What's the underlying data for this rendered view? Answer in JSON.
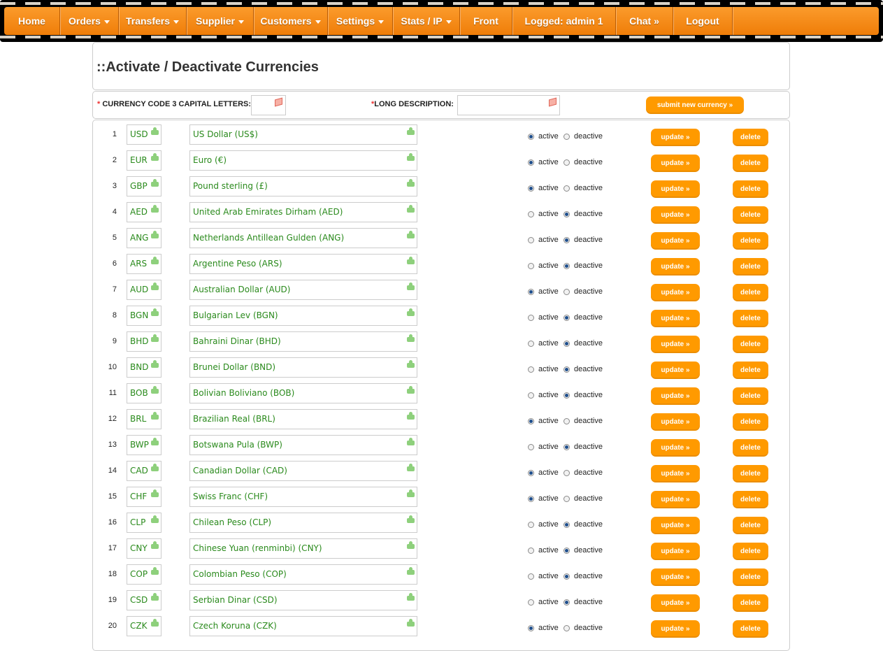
{
  "nav": {
    "items": [
      {
        "label": "Home",
        "caret": false
      },
      {
        "label": "Orders",
        "caret": true
      },
      {
        "label": "Transfers",
        "caret": true
      },
      {
        "label": "Supplier",
        "caret": true
      },
      {
        "label": "Customers",
        "caret": true
      },
      {
        "label": "Settings",
        "caret": true
      },
      {
        "label": "Stats / IP",
        "caret": true
      },
      {
        "label": "Front",
        "caret": false
      },
      {
        "label": "Logged: admin 1",
        "caret": false
      },
      {
        "label": "Chat »",
        "caret": false
      },
      {
        "label": "Logout",
        "caret": false
      }
    ]
  },
  "page": {
    "title": "::Activate / Deactivate Currencies"
  },
  "form": {
    "required_mark": "*",
    "code_label": " CURRENCY CODE 3 CAPITAL LETTERS:",
    "desc_label": "LONG DESCRIPTION:",
    "code_value": "",
    "desc_value": "",
    "submit_label": "submit new currency »"
  },
  "labels": {
    "active": "active",
    "deactive": "deactive",
    "update": "update »",
    "delete": "delete"
  },
  "colors": {
    "accent": "#ff9a00",
    "text_green": "#2a8a1c"
  },
  "currencies": [
    {
      "n": "1",
      "code": "USD",
      "desc": "US Dollar (US$)",
      "active": true
    },
    {
      "n": "2",
      "code": "EUR",
      "desc": "Euro (€)",
      "active": true
    },
    {
      "n": "3",
      "code": "GBP",
      "desc": "Pound sterling (£)",
      "active": true
    },
    {
      "n": "4",
      "code": "AED",
      "desc": "United Arab Emirates Dirham (AED)",
      "active": false
    },
    {
      "n": "5",
      "code": "ANG",
      "desc": "Netherlands Antillean Gulden (ANG)",
      "active": false
    },
    {
      "n": "6",
      "code": "ARS",
      "desc": "Argentine Peso (ARS)",
      "active": false
    },
    {
      "n": "7",
      "code": "AUD",
      "desc": "Australian Dollar (AUD)",
      "active": true
    },
    {
      "n": "8",
      "code": "BGN",
      "desc": "Bulgarian Lev (BGN)",
      "active": false
    },
    {
      "n": "9",
      "code": "BHD",
      "desc": "Bahraini Dinar (BHD)",
      "active": false
    },
    {
      "n": "10",
      "code": "BND",
      "desc": "Brunei Dollar (BND)",
      "active": false
    },
    {
      "n": "11",
      "code": "BOB",
      "desc": "Bolivian Boliviano (BOB)",
      "active": false
    },
    {
      "n": "12",
      "code": "BRL",
      "desc": "Brazilian Real (BRL)",
      "active": true
    },
    {
      "n": "13",
      "code": "BWP",
      "desc": "Botswana Pula (BWP)",
      "active": false
    },
    {
      "n": "14",
      "code": "CAD",
      "desc": "Canadian Dollar (CAD)",
      "active": true
    },
    {
      "n": "15",
      "code": "CHF",
      "desc": "Swiss Franc (CHF)",
      "active": true
    },
    {
      "n": "16",
      "code": "CLP",
      "desc": "Chilean Peso (CLP)",
      "active": false
    },
    {
      "n": "17",
      "code": "CNY",
      "desc": "Chinese Yuan (renminbi) (CNY)",
      "active": false
    },
    {
      "n": "18",
      "code": "COP",
      "desc": "Colombian Peso (COP)",
      "active": false
    },
    {
      "n": "19",
      "code": "CSD",
      "desc": "Serbian Dinar (CSD)",
      "active": false
    },
    {
      "n": "20",
      "code": "CZK",
      "desc": "Czech Koruna (CZK)",
      "active": true
    }
  ]
}
